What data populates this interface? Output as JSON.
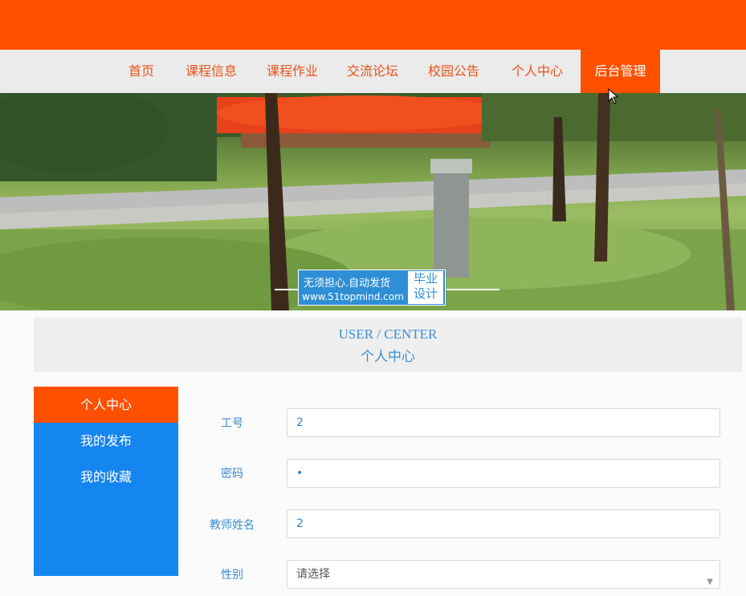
{
  "nav": {
    "items": [
      {
        "label": "首页",
        "name": "nav-home"
      },
      {
        "label": "课程信息",
        "name": "nav-course-info"
      },
      {
        "label": "课程作业",
        "name": "nav-course-homework"
      },
      {
        "label": "交流论坛",
        "name": "nav-forum"
      },
      {
        "label": "校园公告",
        "name": "nav-announcements"
      },
      {
        "label": "个人中心",
        "name": "nav-personal-center"
      },
      {
        "label": "后台管理",
        "name": "nav-admin"
      }
    ],
    "active_index": 6
  },
  "watermark": {
    "line1": "无须担心.自动发货",
    "line2": "www.51topmind.com",
    "side1": "毕业",
    "side2": "设计"
  },
  "section": {
    "title_en": "USER / CENTER",
    "title_cn": "个人中心"
  },
  "sidebar": {
    "items": [
      {
        "label": "个人中心"
      },
      {
        "label": "我的发布"
      },
      {
        "label": "我的收藏"
      }
    ],
    "active_index": 0
  },
  "form": {
    "work_id": {
      "label": "工号",
      "value": "2"
    },
    "password": {
      "label": "密码",
      "value": "•"
    },
    "teacher_name": {
      "label": "教师姓名",
      "value": "2"
    },
    "gender": {
      "label": "性别",
      "placeholder": "请选择"
    }
  },
  "colors": {
    "brand_orange": "#ff5000",
    "nav_bg": "#ebebeb",
    "sidebar_blue": "#1585f0",
    "label_blue": "#3a8ad0"
  }
}
